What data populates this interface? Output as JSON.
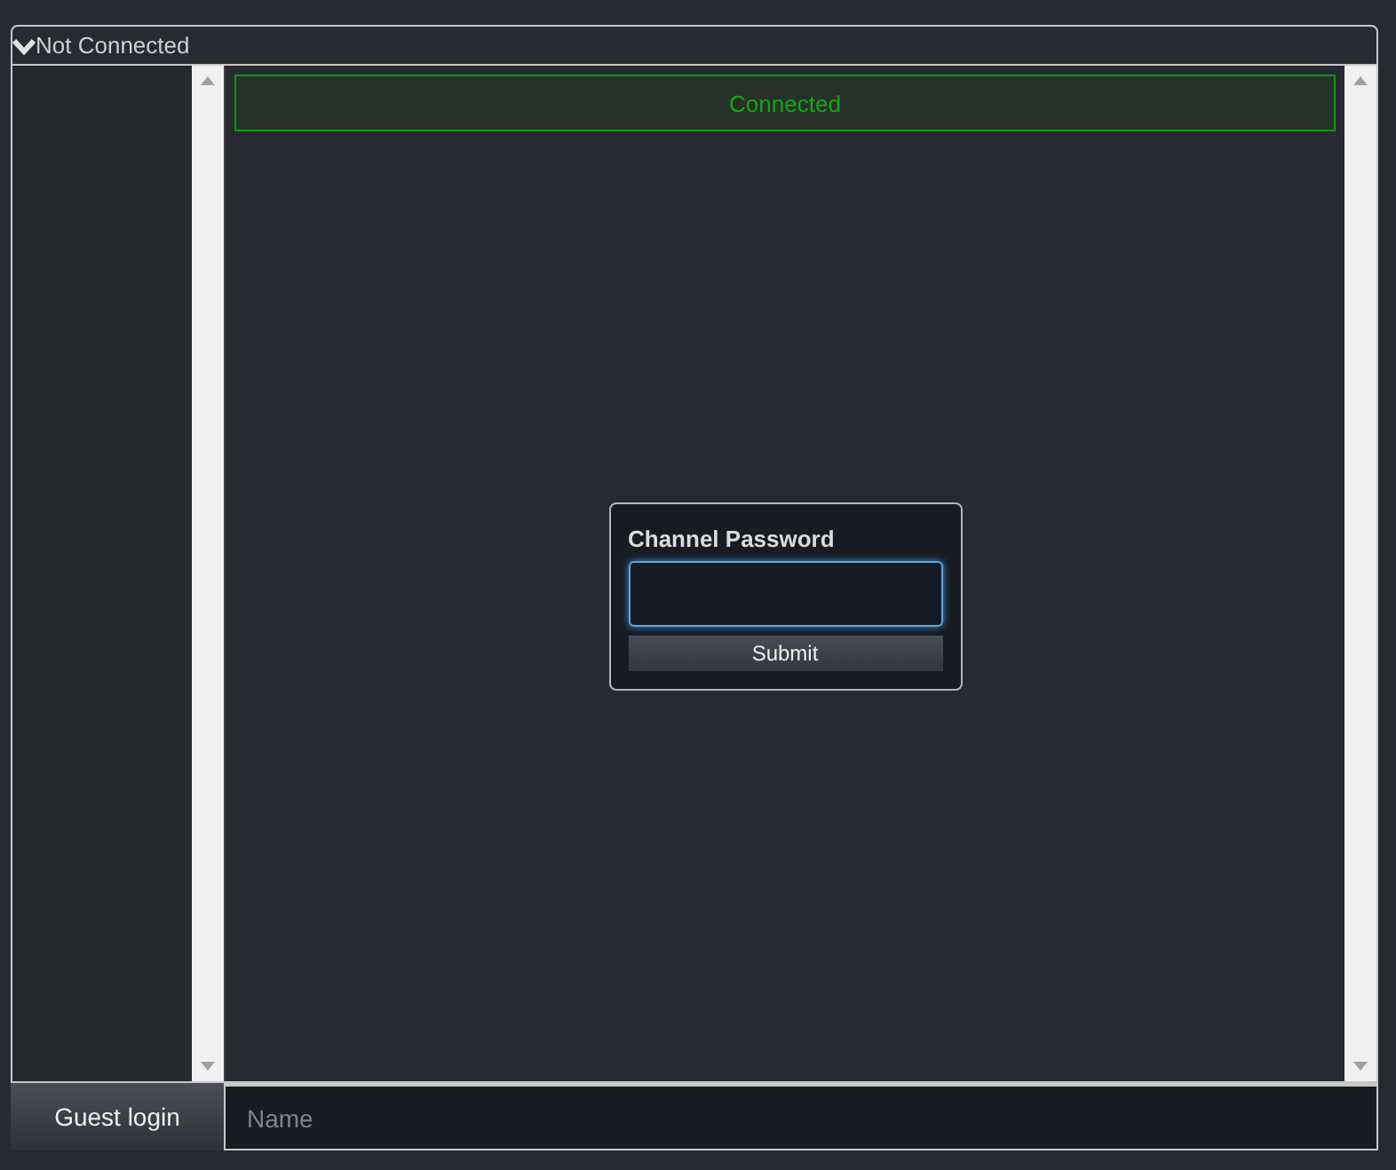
{
  "header": {
    "title": "Not Connected",
    "expanded": true
  },
  "status": {
    "text": "Connected"
  },
  "dialog": {
    "title": "Channel Password",
    "button": "Submit"
  },
  "footer": {
    "button": "Guest login",
    "name_field": {
      "placeholder": "Name"
    }
  }
}
